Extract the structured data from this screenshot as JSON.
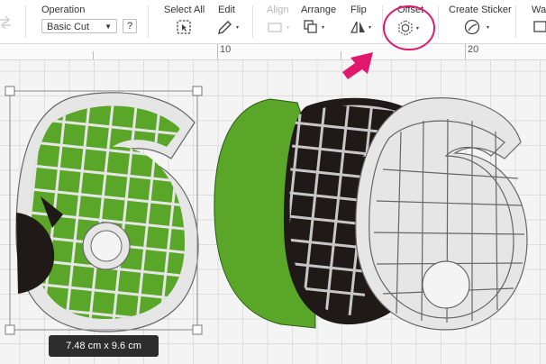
{
  "toolbar": {
    "operation_label": "Operation",
    "operation_value": "Basic Cut",
    "help_label": "?",
    "select_all_label": "Select All",
    "edit_label": "Edit",
    "align_label": "Align",
    "arrange_label": "Arrange",
    "flip_label": "Flip",
    "offset_label": "Offset",
    "create_sticker_label": "Create Sticker",
    "warp_label_partial": "Wa"
  },
  "ruler": {
    "label_10": "10",
    "label_20": "20"
  },
  "selection": {
    "size_label": "7.48  cm x 9.6  cm"
  },
  "colors": {
    "accent_pink": "#e0196f",
    "green": "#5aa628",
    "black": "#1f1a17",
    "gray": "#e6e6e6",
    "toolbar_bg": "#ffffff"
  }
}
